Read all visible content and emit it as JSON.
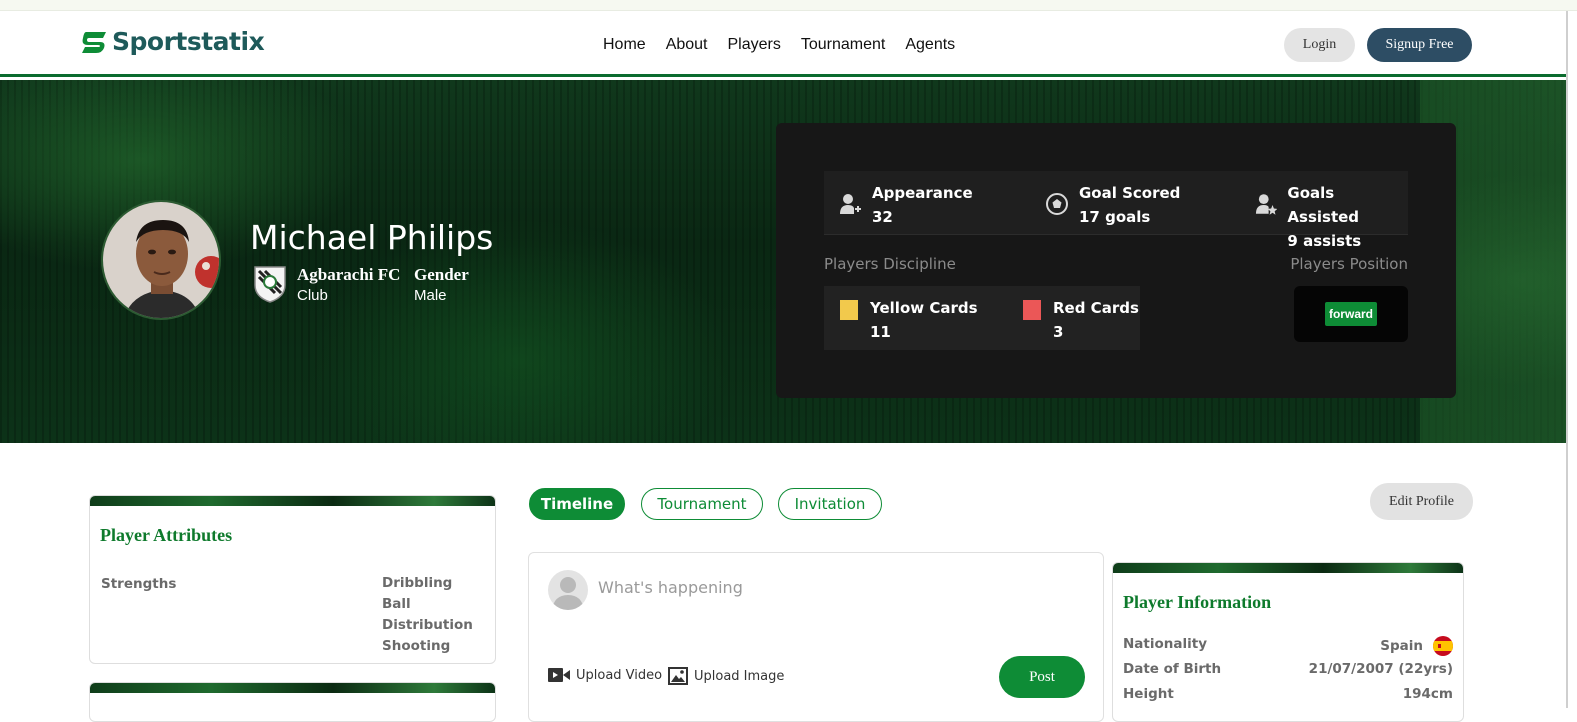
{
  "brand": {
    "name": "Sportstatix"
  },
  "nav": {
    "links": [
      "Home",
      "About",
      "Players",
      "Tournament",
      "Agents"
    ],
    "login": "Login",
    "signup": "Signup Free"
  },
  "profile": {
    "name": "Michael Philips",
    "club": {
      "name": "Agbarachi FC",
      "label": "Club"
    },
    "gender": {
      "title": "Gender",
      "value": "Male"
    }
  },
  "stats": {
    "appearance": {
      "label": "Appearance",
      "value": "32",
      "icon": "user-plus-icon"
    },
    "goals": {
      "label": "Goal Scored",
      "value": "17 goals",
      "icon": "soccer-ball-icon"
    },
    "assists": {
      "label": "Goals Assisted",
      "value": "9 assists",
      "icon": "user-star-icon"
    }
  },
  "discipline": {
    "title": "Players Discipline",
    "yellow": {
      "label": "Yellow Cards",
      "value": "11",
      "color": "#f2c94c"
    },
    "red": {
      "label": "Red Cards",
      "value": "3",
      "color": "#eb5757"
    }
  },
  "position": {
    "title": "Players Position",
    "value": "forward"
  },
  "tabs": {
    "timeline": "Timeline",
    "tournament": "Tournament",
    "invitation": "Invitation",
    "edit": "Edit Profile"
  },
  "attributes": {
    "title": "Player Attributes",
    "strengths_label": "Strengths",
    "strengths": [
      "Dribbling",
      "Ball Distribution",
      "Shooting"
    ]
  },
  "composer": {
    "placeholder": "What's happening",
    "upload_video": "Upload Video",
    "upload_image": "Upload Image",
    "post": "Post"
  },
  "info": {
    "title": "Player Information",
    "rows": [
      {
        "label": "Nationality",
        "value": "Spain"
      },
      {
        "label": "Date of Birth",
        "value": "21/07/2007 (22yrs)"
      },
      {
        "label": "Height",
        "value": "194cm"
      }
    ]
  },
  "colors": {
    "accent": "#0e8c36",
    "signup": "#2d4d64",
    "heading": "#0e7a2c"
  }
}
